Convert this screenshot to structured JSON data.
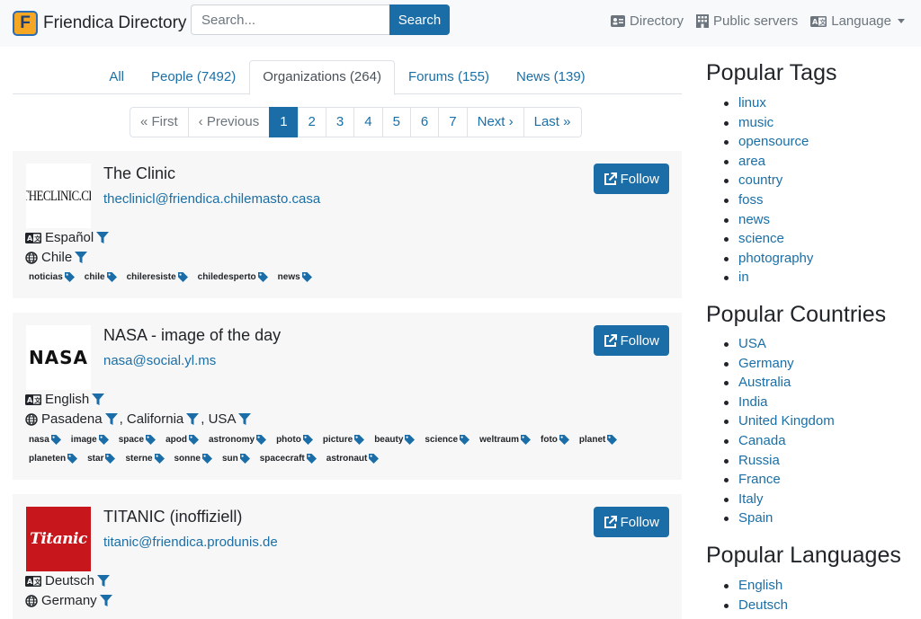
{
  "brand": {
    "title": "Friendica Directory",
    "logo_letter": "F"
  },
  "search": {
    "placeholder": "Search...",
    "button": "Search"
  },
  "nav": {
    "directory": "Directory",
    "public_servers": "Public servers",
    "language": "Language"
  },
  "tabs": [
    {
      "label": "All"
    },
    {
      "label": "People (7492)"
    },
    {
      "label": "Organizations (264)"
    },
    {
      "label": "Forums (155)"
    },
    {
      "label": "News (139)"
    }
  ],
  "pagination": [
    "« First",
    "‹ Previous",
    "1",
    "2",
    "3",
    "4",
    "5",
    "6",
    "7",
    "Next ›",
    "Last »"
  ],
  "follow_label": "Follow",
  "cards": [
    {
      "name": "The Clinic",
      "address": "theclinicl@friendica.chilemasto.casa",
      "avatar_text": "THECLINIC.CL",
      "language": "Español",
      "location": [
        "Chile"
      ],
      "tags": [
        "noticias",
        "chile",
        "chileresiste",
        "chiledesperto",
        "news"
      ]
    },
    {
      "name": "NASA - image of the day",
      "address": "nasa@social.yl.ms",
      "avatar_text": "NASA",
      "language": "English",
      "location": [
        "Pasadena",
        ", California",
        ", USA"
      ],
      "tags": [
        "nasa",
        "image",
        "space",
        "apod",
        "astronomy",
        "photo",
        "picture",
        "beauty",
        "science",
        "weltraum",
        "foto",
        "planet",
        "planeten",
        "star",
        "sterne",
        "sonne",
        "sun",
        "spacecraft",
        "astronaut"
      ]
    },
    {
      "name": "TITANIC (inoffiziell)",
      "address": "titanic@friendica.produnis.de",
      "avatar_text": "Titanic",
      "language": "Deutsch",
      "location": [
        "Germany"
      ]
    }
  ],
  "sidebar": {
    "tags_title": "Popular Tags",
    "tags": [
      "linux",
      "music",
      "opensource",
      "area",
      "country",
      "foss",
      "news",
      "science",
      "photography",
      "in"
    ],
    "countries_title": "Popular Countries",
    "countries": [
      "USA",
      "Germany",
      "Australia",
      "India",
      "United Kingdom",
      "Canada",
      "Russia",
      "France",
      "Italy",
      "Spain"
    ],
    "languages_title": "Popular Languages",
    "languages": [
      "English",
      "Deutsch"
    ]
  },
  "colors": {
    "primary": "#1b6da8",
    "link": "#1a6fa6",
    "card_bg": "#f7f7f7",
    "navbar_bg": "#f8f9fa"
  }
}
